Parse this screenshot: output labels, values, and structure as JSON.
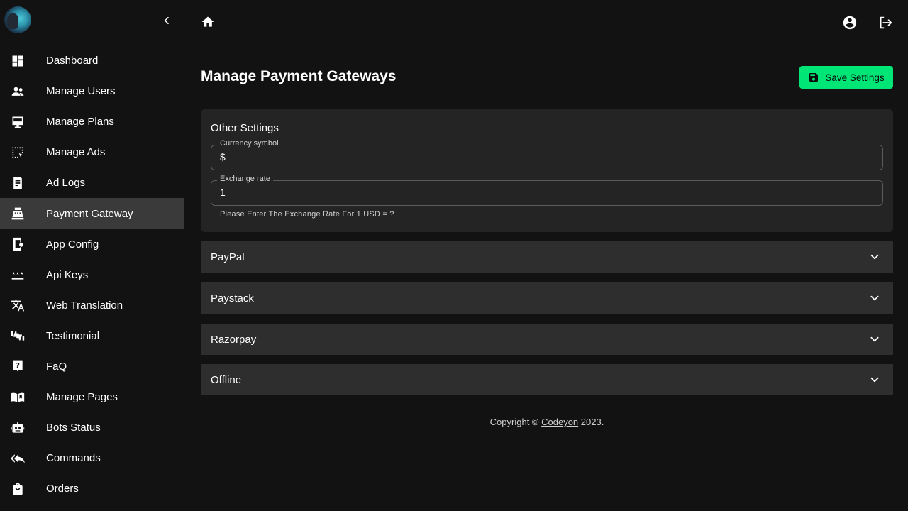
{
  "sidebar": {
    "items": [
      {
        "label": "Dashboard",
        "icon": "dashboard-icon"
      },
      {
        "label": "Manage Users",
        "icon": "users-icon"
      },
      {
        "label": "Manage Plans",
        "icon": "plans-icon"
      },
      {
        "label": "Manage Ads",
        "icon": "ads-icon"
      },
      {
        "label": "Ad Logs",
        "icon": "logs-icon"
      },
      {
        "label": "Payment Gateway",
        "icon": "cash-register-icon",
        "active": true
      },
      {
        "label": "App Config",
        "icon": "app-config-icon"
      },
      {
        "label": "Api Keys",
        "icon": "api-keys-icon"
      },
      {
        "label": "Web Translation",
        "icon": "translate-icon"
      },
      {
        "label": "Testimonial",
        "icon": "thumbs-icon"
      },
      {
        "label": "FaQ",
        "icon": "question-icon"
      },
      {
        "label": "Manage Pages",
        "icon": "book-icon"
      },
      {
        "label": "Bots Status",
        "icon": "bot-icon"
      },
      {
        "label": "Commands",
        "icon": "reply-all-icon"
      },
      {
        "label": "Orders",
        "icon": "shopping-bag-icon"
      }
    ]
  },
  "header": {
    "title": "Manage Payment Gateways",
    "save_label": "Save Settings"
  },
  "other_settings": {
    "title": "Other Settings",
    "currency_label": "Currency symbol",
    "currency_value": "$",
    "exchange_label": "Exchange rate",
    "exchange_value": "1",
    "helper": "Please Enter The Exchange Rate For 1 USD = ?"
  },
  "gateways": [
    "PayPal",
    "Paystack",
    "Razorpay",
    "Offline"
  ],
  "footer": {
    "prefix": "Copyright © ",
    "link": "Codeyon",
    "suffix": " 2023."
  },
  "colors": {
    "background": "#121212",
    "accent": "#00e676",
    "card": "#242424",
    "accordion": "#2e2e2e",
    "active_item": "#3a3a3a"
  }
}
